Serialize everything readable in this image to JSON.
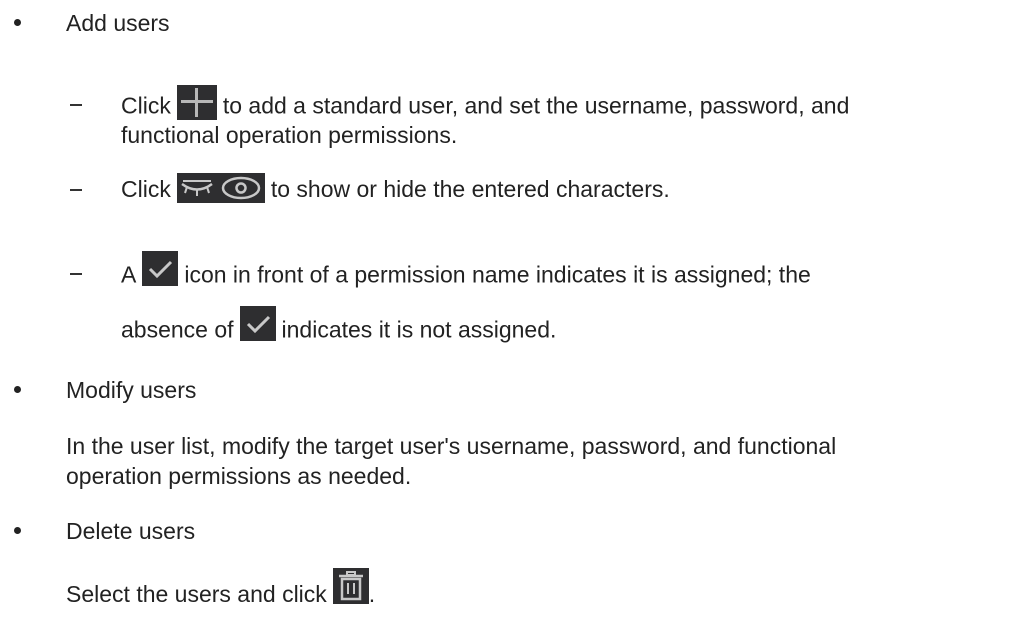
{
  "items": [
    {
      "heading": "Add users",
      "subitems": [
        {
          "pre": "Click",
          "icon": "plus-icon",
          "post_line1": "to add a standard user, and set the username, password, and",
          "line2": "functional operation permissions."
        },
        {
          "pre": "Click",
          "icon": "eye-toggle-icons",
          "post": "to show or hide the entered characters."
        },
        {
          "pre": "A",
          "icon": "checkmark-icon",
          "post_line1": "icon in front of a permission name indicates it is assigned; the",
          "line2_pre": "absence of",
          "line2_post": "indicates it is not assigned."
        }
      ]
    },
    {
      "heading": "Modify users",
      "body_line1": "In the user list, modify the target user's username, password, and functional",
      "body_line2": "operation permissions as needed."
    },
    {
      "heading": "Delete users",
      "body_pre": "Select the users and click",
      "icon": "trash-icon",
      "body_post": "."
    }
  ],
  "colors": {
    "text": "#222222",
    "icon_bg": "#2e2e30",
    "icon_fg": "#b8b8b8",
    "check_fg": "#c8c8c8"
  }
}
